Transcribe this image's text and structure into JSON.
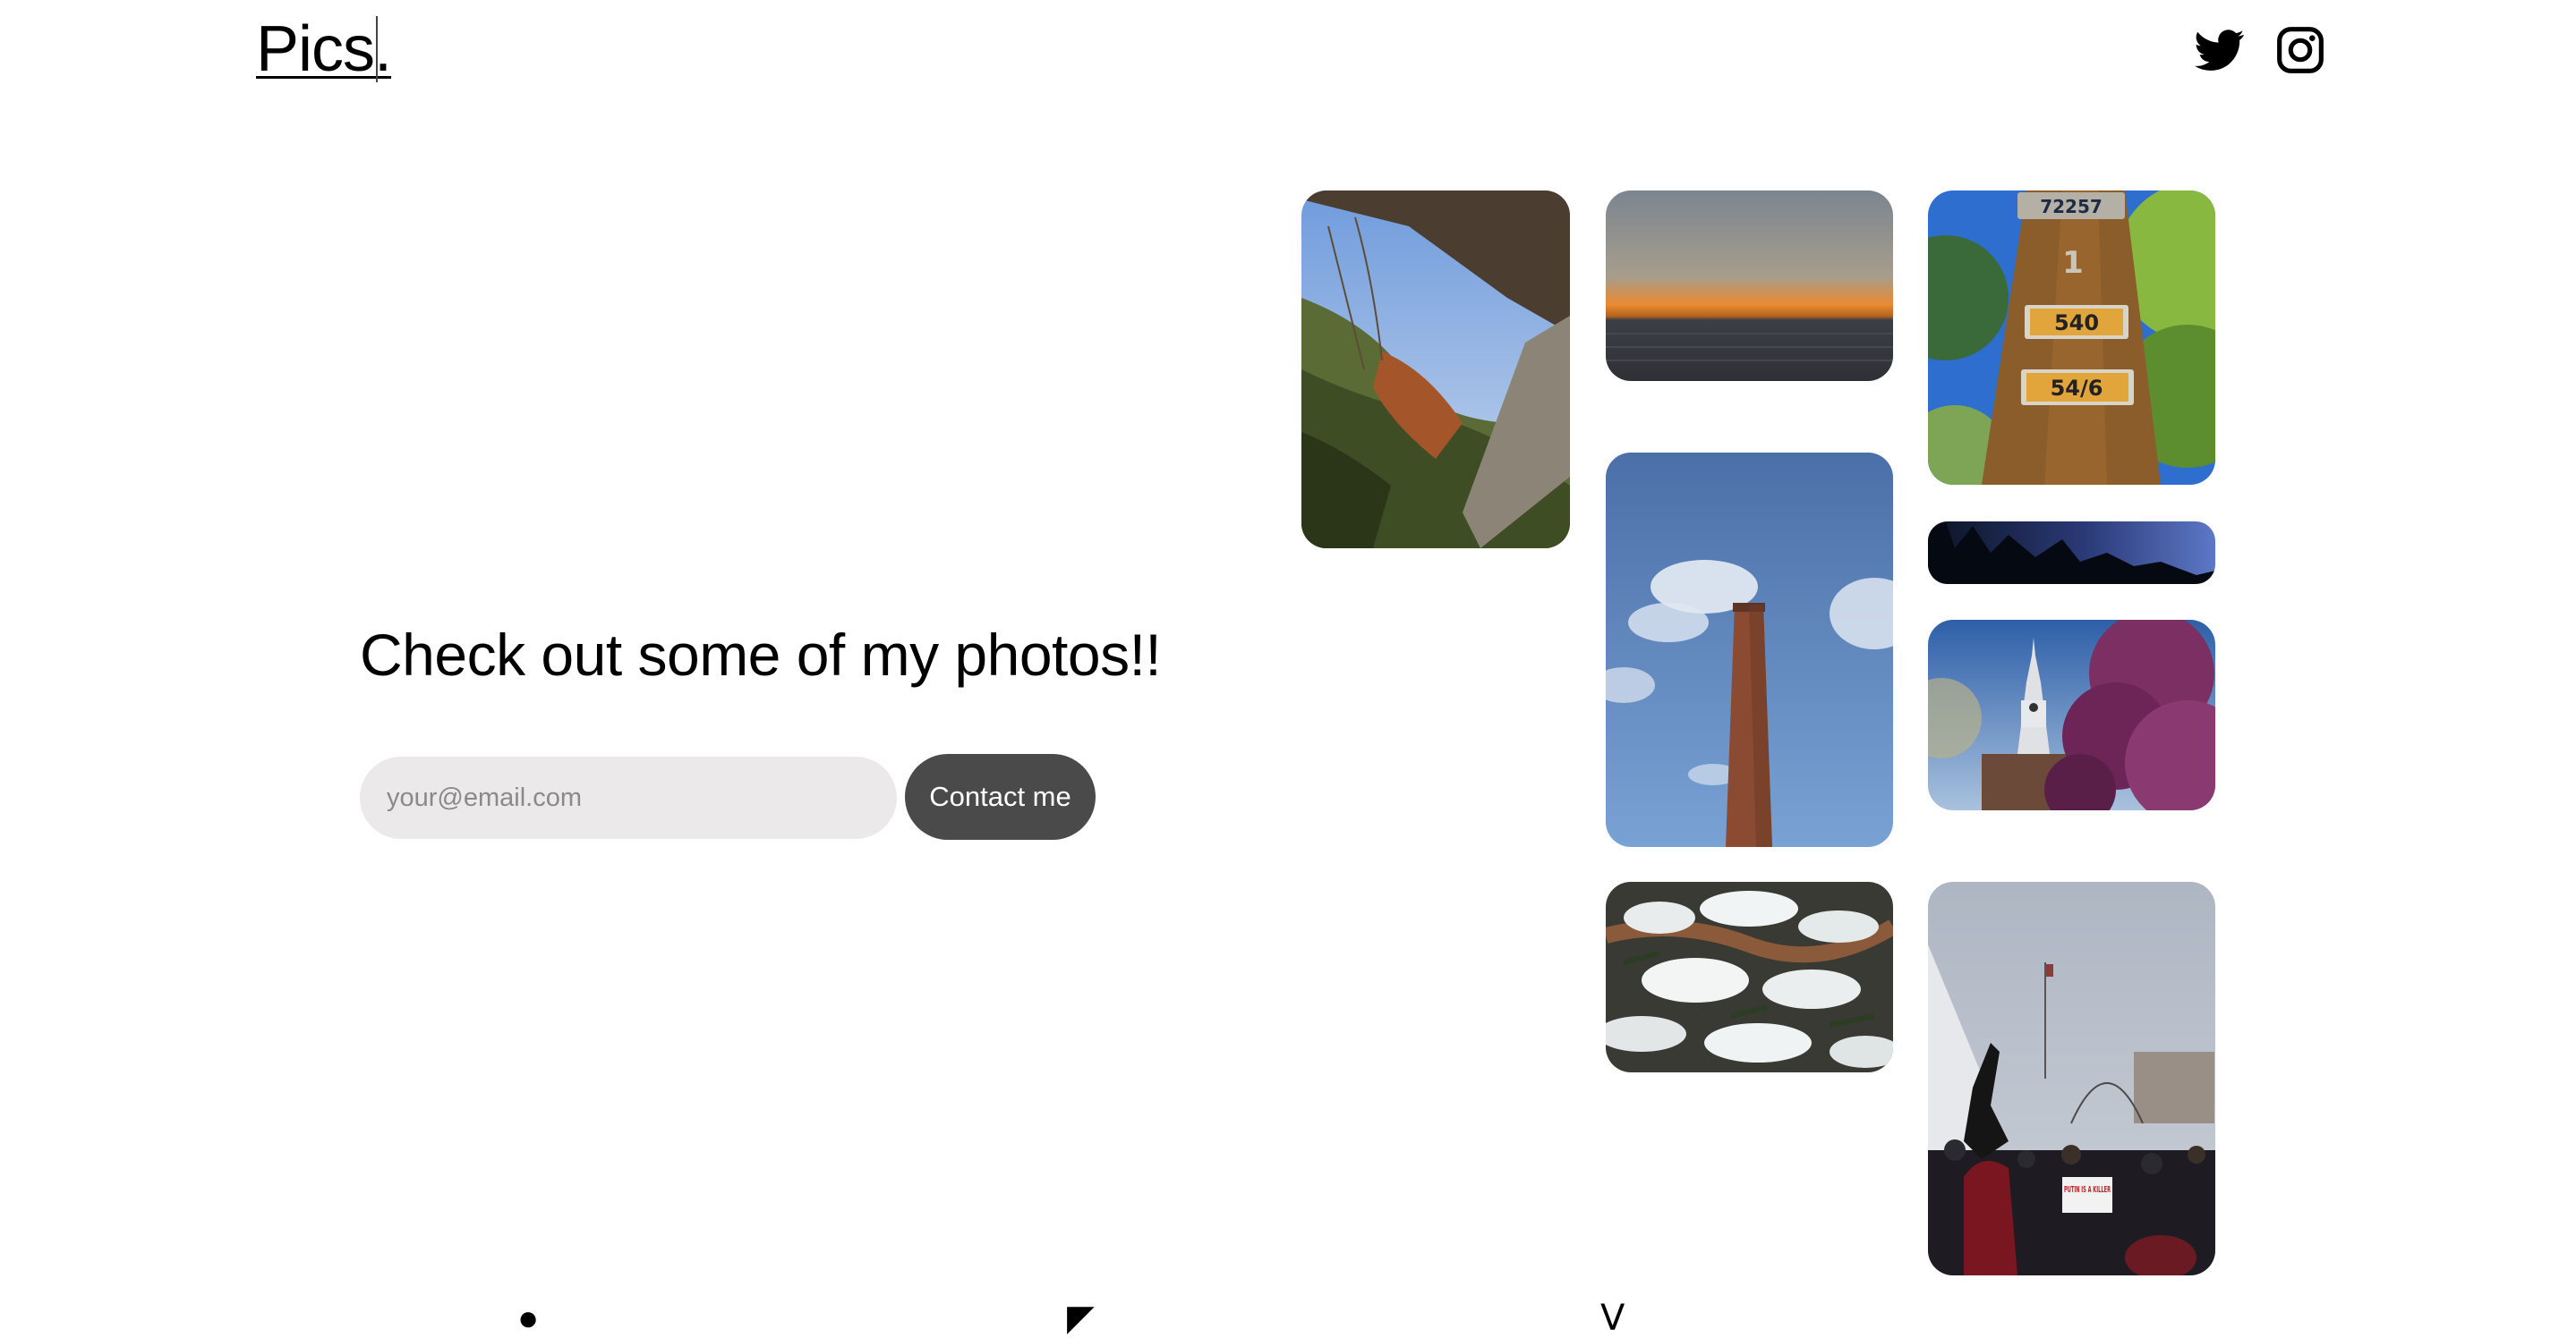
{
  "header": {
    "logo": "Pics.",
    "social_icons": [
      "twitter-icon",
      "instagram-icon"
    ]
  },
  "hero": {
    "title": "Check out some of my photos!!",
    "email_placeholder": "your@email.com",
    "contact_button": "Contact me"
  },
  "gallery": {
    "photos": [
      {
        "subject": "plants-window"
      },
      {
        "subject": "sunset-water"
      },
      {
        "subject": "utility-pole"
      },
      {
        "subject": "smokestack-sky"
      },
      {
        "subject": "treeline-dusk"
      },
      {
        "subject": "clock-tower-blossoms"
      },
      {
        "subject": "snowy-evergreen"
      },
      {
        "subject": "snowy-protest"
      }
    ],
    "pole_tags": [
      "72257",
      "1",
      "540",
      "54/6"
    ],
    "protest_sign": "PUTIN IS A KILLER"
  },
  "colors": {
    "button": "#4a4a4a",
    "input_bg": "#ece9ea"
  }
}
